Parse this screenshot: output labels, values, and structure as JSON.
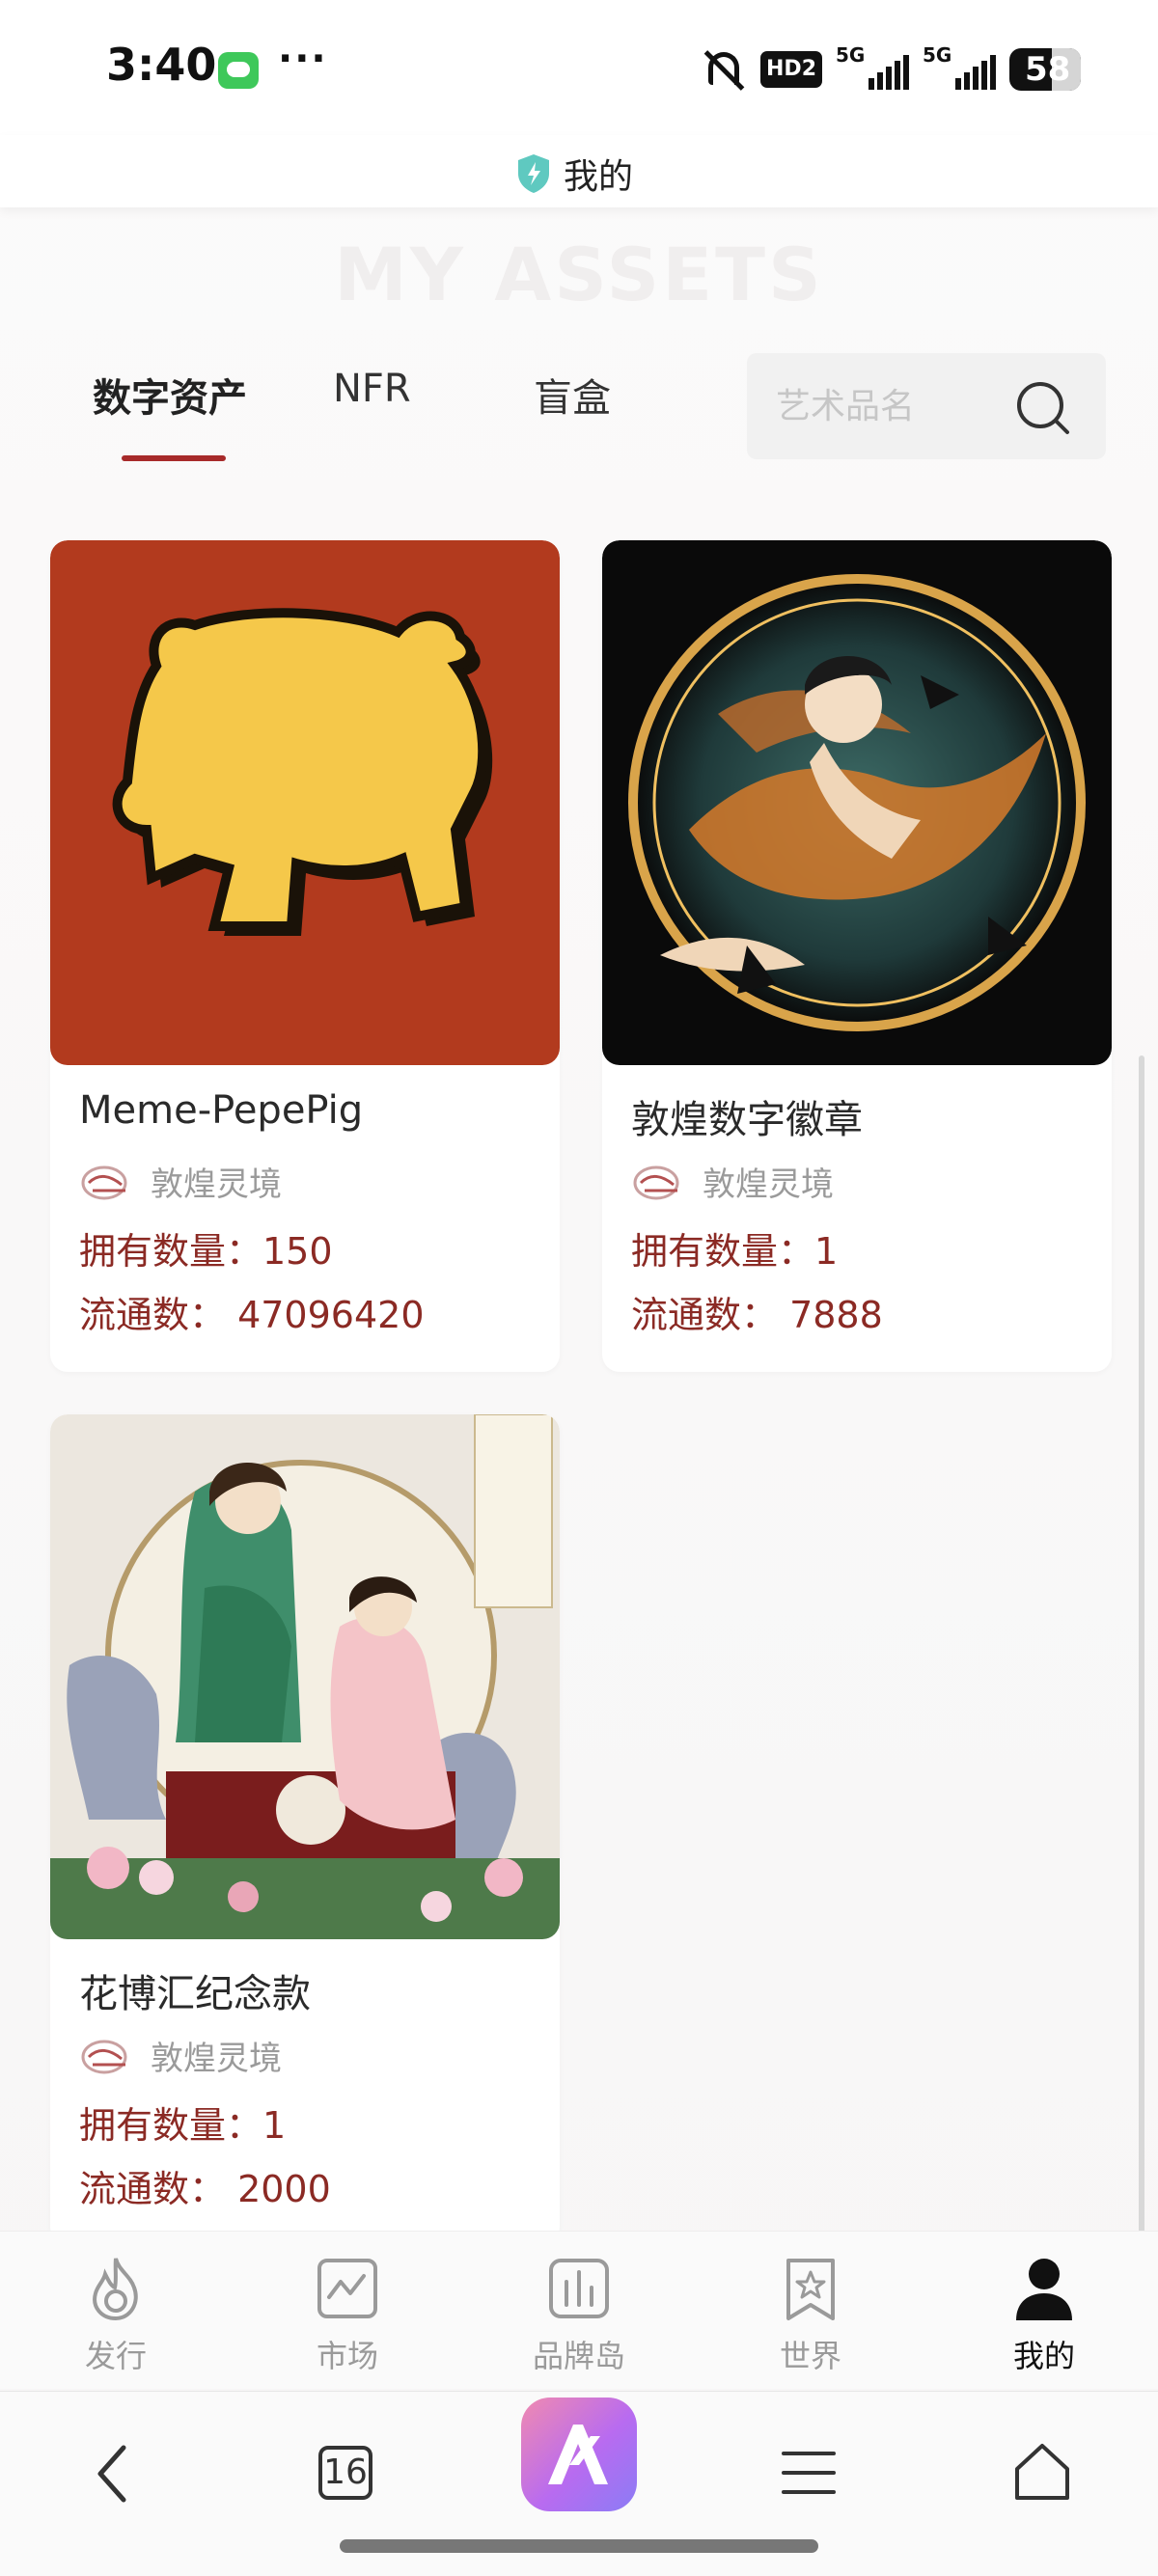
{
  "status_bar": {
    "time": "3:40",
    "more_dots": "···",
    "hd_label": "HD2",
    "signal_1": "5G",
    "signal_2": "5G",
    "battery": "58"
  },
  "header": {
    "title": "我的",
    "icon": "shield-bolt-icon"
  },
  "watermark": "MY ASSETS",
  "tabs": [
    {
      "label": "数字资产",
      "active": true
    },
    {
      "label": "NFR",
      "active": false
    },
    {
      "label": "盲盒",
      "active": false
    }
  ],
  "search": {
    "placeholder": "艺术品名"
  },
  "cards": [
    {
      "name": "Meme-PepePig",
      "brand": "敦煌灵境",
      "owned": "拥有数量：150",
      "circulation": "流通数：  47096420"
    },
    {
      "name": "敦煌数字徽章",
      "brand": "敦煌灵境",
      "owned": "拥有数量：1",
      "circulation": "流通数：  7888"
    },
    {
      "name": "花博汇纪念款",
      "brand": "敦煌灵境",
      "owned": "拥有数量：1",
      "circulation": "流通数：  2000"
    }
  ],
  "bottom_nav": [
    {
      "label": "发行",
      "icon": "flame-icon"
    },
    {
      "label": "市场",
      "icon": "trend-chart-icon"
    },
    {
      "label": "品牌岛",
      "icon": "bar-chart-icon"
    },
    {
      "label": "世界",
      "icon": "star-bookmark-icon"
    },
    {
      "label": "我的",
      "icon": "user-icon",
      "active": true
    }
  ],
  "browser_bar": {
    "tab_count": "16"
  },
  "colors": {
    "accent": "#a72a2a",
    "stat_text": "#8b2a24",
    "pig_bg": "#b23a1e",
    "pig_yellow": "#f5c84a"
  }
}
